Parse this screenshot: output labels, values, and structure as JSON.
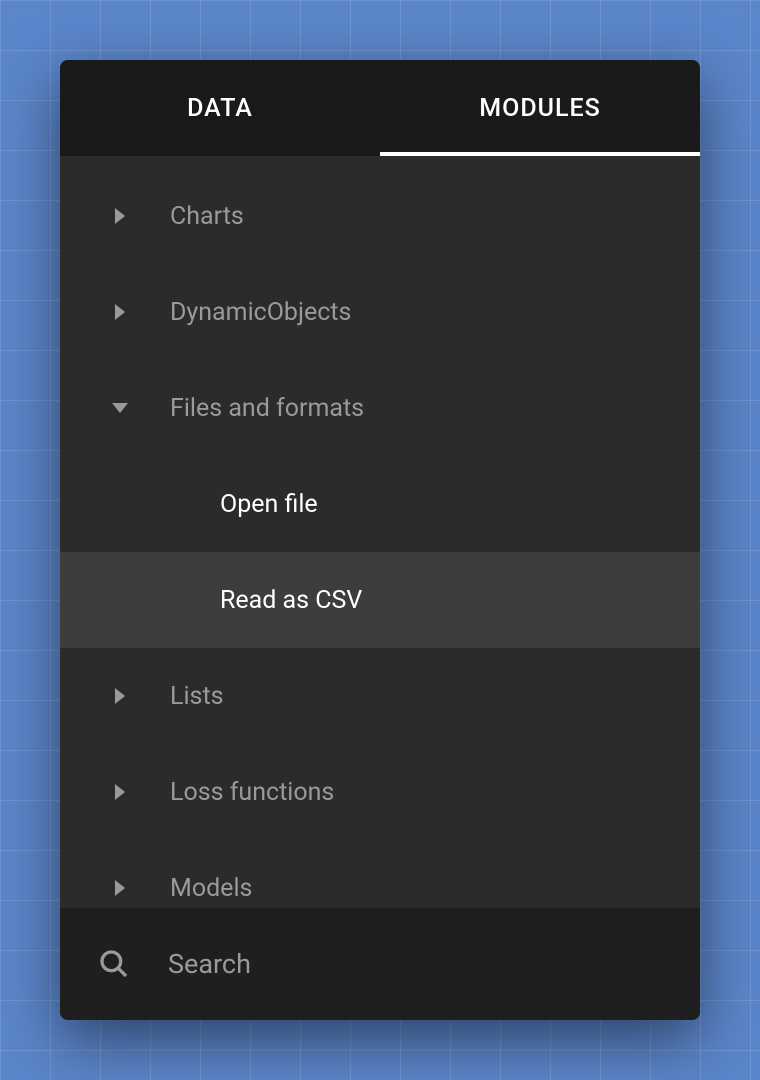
{
  "tabs": {
    "data": "DATA",
    "modules": "MODULES",
    "active": "modules"
  },
  "tree": {
    "categories": [
      {
        "label": "Charts",
        "expanded": false
      },
      {
        "label": "DynamicObjects",
        "expanded": false
      },
      {
        "label": "Files and formats",
        "expanded": true,
        "items": [
          {
            "label": "Open file",
            "selected": false
          },
          {
            "label": "Read as CSV",
            "selected": true
          }
        ]
      },
      {
        "label": "Lists",
        "expanded": false
      },
      {
        "label": "Loss functions",
        "expanded": false
      },
      {
        "label": "Models",
        "expanded": false
      }
    ]
  },
  "search": {
    "placeholder": "Search",
    "value": ""
  }
}
